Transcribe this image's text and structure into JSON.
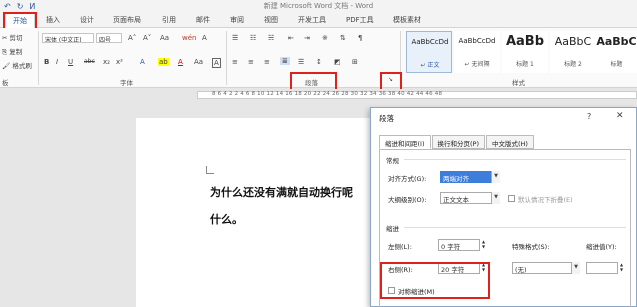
{
  "window": {
    "title": "新建 Microsoft Word 文档 - Word"
  },
  "qat": {
    "undo": "↶",
    "redo": "↻",
    "extra": "ⵍ"
  },
  "tabs": [
    "开始",
    "插入",
    "设计",
    "页面布局",
    "引用",
    "邮件",
    "审阅",
    "视图",
    "开发工具",
    "PDF工具",
    "模板素材"
  ],
  "clipboard": {
    "cut": "剪切",
    "copy": "复制",
    "painter": "格式刷",
    "group": "板"
  },
  "font": {
    "name": "宋体 (中文正)",
    "size": "四号",
    "group_label": "字体",
    "row1_icons": [
      "A˄",
      "A˅",
      "Aa",
      "wén",
      "A"
    ],
    "row2_icons": [
      "B",
      "I",
      "U",
      "abc",
      "x₂",
      "x²",
      "A",
      "ab",
      "A",
      "Aa",
      "A"
    ]
  },
  "paragraph": {
    "group_label": "段落",
    "launcher": "↘"
  },
  "styles": {
    "group_label": "样式",
    "tiles": [
      {
        "sample": "AaBbCcDd",
        "name": "↵ 正文"
      },
      {
        "sample": "AaBbCcDd",
        "name": "↵ 无间隔"
      },
      {
        "sample": "AaBb",
        "name": "标题 1"
      },
      {
        "sample": "AaBbC",
        "name": "标题 2"
      },
      {
        "sample": "AaBbC",
        "name": "标题"
      }
    ]
  },
  "ruler": {
    "numbers": "8  6  4  2     2  4  6  8  10  12  14  16  18  20  22  24  26  28  30  32  34  36  38  40  42  44  46  48"
  },
  "document": {
    "line1": "为什么还没有满就自动换行呢",
    "line2": "什么。"
  },
  "dialog": {
    "title": "段落",
    "help": "?",
    "close": "✕",
    "tabs": [
      "缩进和间距(I)",
      "换行和分页(P)",
      "中文版式(H)"
    ],
    "general": {
      "section": "常规",
      "align_label": "对齐方式(G):",
      "align_value": "两端对齐",
      "outline_label": "大纲级别(O):",
      "outline_value": "正文文本",
      "collapse_label": "默认情况下折叠(E)"
    },
    "indent": {
      "section": "缩进",
      "left_label": "左侧(L):",
      "left_value": "0 字符",
      "right_label": "右侧(R):",
      "right_value": "20 字符",
      "special_label": "特殊格式(S):",
      "special_value": "(无)",
      "indent_value_label": "缩进值(Y):",
      "indent_value": "",
      "mirror_label": "对称缩进(M)"
    }
  },
  "colors": {
    "highlight": "#e0201b",
    "accent": "#2b579a",
    "selected": "#3d7edb"
  }
}
